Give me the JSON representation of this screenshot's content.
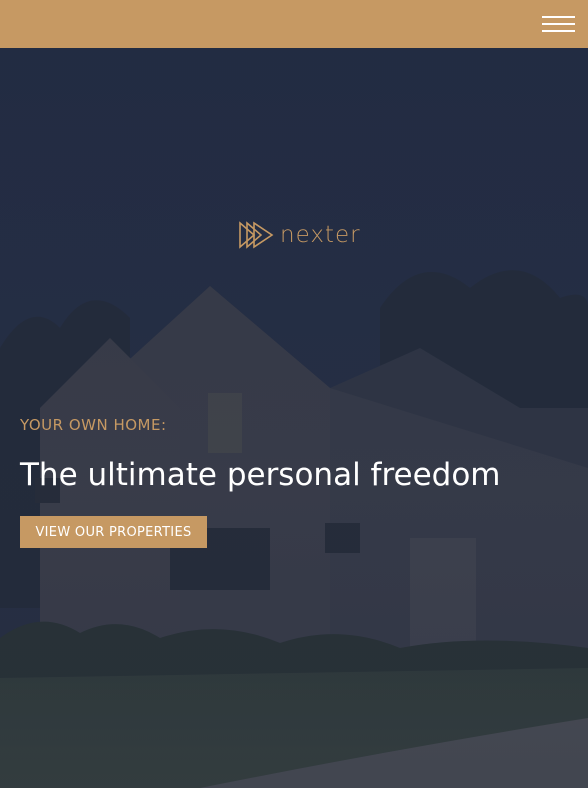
{
  "header": {
    "menu_icon": "hamburger-menu-icon",
    "background_color": "#c69963"
  },
  "logo": {
    "icon": "triple-play-triangle-icon",
    "text": "nexter",
    "color": "#c69963"
  },
  "hero": {
    "background_image": "house-at-dusk-photo",
    "eyebrow": "YOUR OWN HOME:",
    "headline": "The ultimate personal freedom",
    "cta_label": "VIEW OUR PROPERTIES",
    "accent_color": "#c69963"
  }
}
